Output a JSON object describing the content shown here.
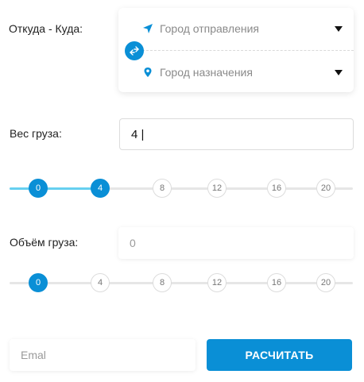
{
  "route": {
    "label": "Откуда - Куда:",
    "from_placeholder": "Город отправления",
    "to_placeholder": "Город назначения"
  },
  "weight": {
    "label": "Вес груза:",
    "value": "4 |",
    "slider": {
      "ticks": [
        "0",
        "4",
        "8",
        "12",
        "16",
        "20"
      ],
      "selected_range": [
        0,
        4
      ]
    }
  },
  "volume": {
    "label": "Объём груза:",
    "placeholder": "0",
    "slider": {
      "ticks": [
        "0",
        "4",
        "8",
        "12",
        "16",
        "20"
      ],
      "selected": 0
    }
  },
  "email": {
    "placeholder": "Emal"
  },
  "submit_label": "РАСЧИТАТЬ",
  "colors": {
    "accent": "#0a8fd6",
    "fill": "#67d0f0"
  }
}
